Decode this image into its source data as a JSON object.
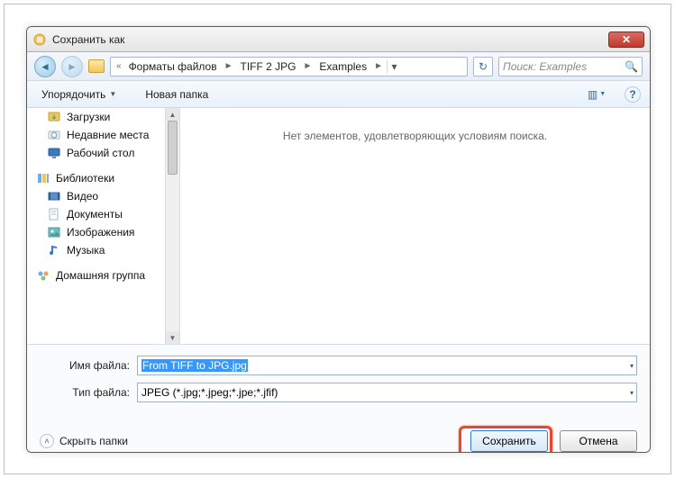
{
  "window": {
    "title": "Сохранить как"
  },
  "nav": {
    "back_glyph": "◄",
    "fwd_glyph": "►",
    "lead_sep": "«",
    "crumbs": [
      "Форматы файлов",
      "TIFF 2 JPG",
      "Examples"
    ],
    "sep": "►",
    "refresh_glyph": "↻",
    "search_placeholder": "Поиск: Examples",
    "search_icon": "🔍"
  },
  "toolbar": {
    "organize": "Упорядочить",
    "new_folder": "Новая папка",
    "dd": "▼",
    "view_icon": "▥",
    "help_icon": "?"
  },
  "sidebar": {
    "items": [
      {
        "label": "Загрузки",
        "icon": "downloads"
      },
      {
        "label": "Недавние места",
        "icon": "recent"
      },
      {
        "label": "Рабочий стол",
        "icon": "desktop"
      }
    ],
    "lib_header": {
      "label": "Библиотеки",
      "icon": "libraries"
    },
    "libs": [
      {
        "label": "Видео",
        "icon": "video"
      },
      {
        "label": "Документы",
        "icon": "docs"
      },
      {
        "label": "Изображения",
        "icon": "images"
      },
      {
        "label": "Музыка",
        "icon": "music"
      }
    ],
    "homegroup": {
      "label": "Домашняя группа",
      "icon": "homegroup"
    },
    "scroll_up": "▲",
    "scroll_down": "▼"
  },
  "content": {
    "empty_msg": "Нет элементов, удовлетворяющих условиям поиска."
  },
  "form": {
    "filename_label": "Имя файла:",
    "filename_value": "From TIFF to JPG.jpg",
    "filetype_label": "Тип файла:",
    "filetype_value": "JPEG (*.jpg;*.jpeg;*.jpe;*.jfif)",
    "dd": "▾"
  },
  "footer": {
    "hide_folders": "Скрыть папки",
    "chev": "˄",
    "save": "Сохранить",
    "cancel": "Отмена"
  }
}
